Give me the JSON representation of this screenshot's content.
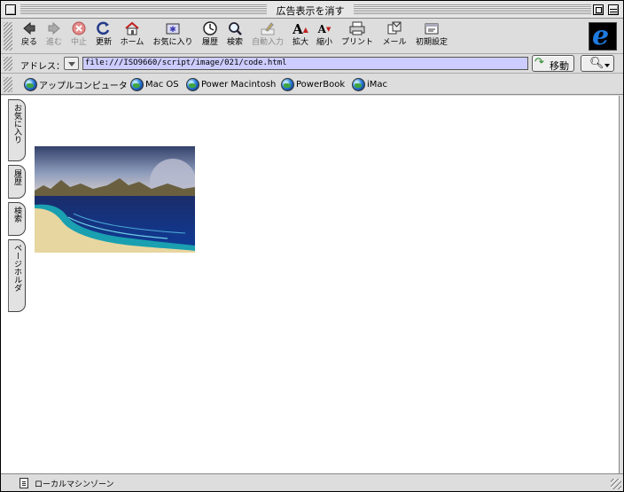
{
  "window": {
    "title": "広告表示を消す"
  },
  "toolbar": {
    "buttons": [
      {
        "label": "戻る",
        "icon": "back-arrow-icon"
      },
      {
        "label": "進む",
        "icon": "forward-arrow-icon"
      },
      {
        "label": "中止",
        "icon": "stop-icon"
      },
      {
        "label": "更新",
        "icon": "refresh-icon"
      },
      {
        "label": "ホーム",
        "icon": "home-icon"
      },
      {
        "label": "お気に入り",
        "icon": "favorites-icon"
      },
      {
        "label": "履歴",
        "icon": "history-icon"
      },
      {
        "label": "検索",
        "icon": "search-icon"
      },
      {
        "label": "自動入力",
        "icon": "autofill-icon"
      },
      {
        "label": "拡大",
        "icon": "text-larger-icon"
      },
      {
        "label": "縮小",
        "icon": "text-smaller-icon"
      },
      {
        "label": "プリント",
        "icon": "print-icon"
      },
      {
        "label": "メール",
        "icon": "mail-icon"
      },
      {
        "label": "初期設定",
        "icon": "preferences-icon"
      }
    ]
  },
  "address": {
    "label": "アドレス：",
    "url": "file:///ISO9660/script/image/021/code.html",
    "go_label": "移動"
  },
  "favorites_bar": {
    "items": [
      {
        "label": "アップルコンピュータ"
      },
      {
        "label": "Mac OS"
      },
      {
        "label": "Power Macintosh"
      },
      {
        "label": "PowerBook"
      },
      {
        "label": "iMac"
      }
    ]
  },
  "side_tabs": [
    "お気に入り",
    "履歴",
    "検索",
    "ページホルダ"
  ],
  "status": {
    "text": "ローカルマシンゾーン"
  },
  "colors": {
    "address_field": "#ccccff",
    "chrome": "#dddddd",
    "ie_logo": "#1e7be0"
  }
}
